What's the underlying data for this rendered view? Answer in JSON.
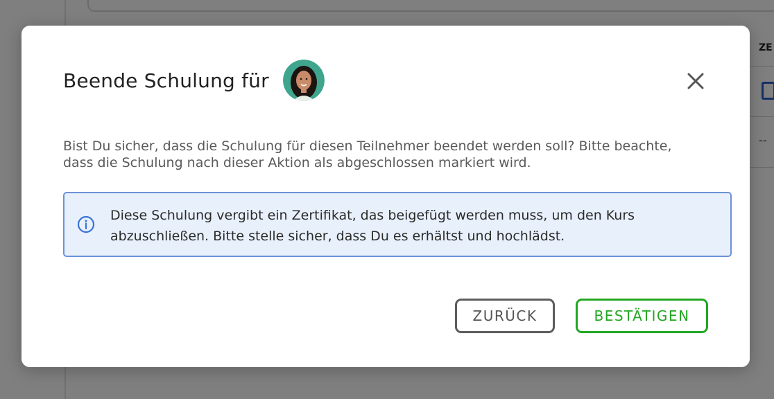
{
  "background": {
    "column_header": "ZE",
    "row_value": "--"
  },
  "dialog": {
    "title": "Beende Schulung für",
    "avatar_icon": "participant-avatar",
    "close_icon": "close-icon",
    "message": "Bist Du sicher, dass die Schulung für diesen Teilnehmer beendet werden soll? Bitte beachte, dass die Schulung nach dieser Aktion als abgeschlossen markiert wird.",
    "info": {
      "icon": "info-icon",
      "text": "Diese Schulung vergibt ein Zertifikat, das beigefügt werden muss, um den Kurs abzuschließen. Bitte stelle sicher, dass Du es erhältst und hochlädst."
    },
    "buttons": {
      "back_label": "ZURÜCK",
      "confirm_label": "BESTÄTIGEN"
    }
  },
  "colors": {
    "confirm": "#22a722",
    "info_border": "#6b92d8",
    "info_background": "#e8f0fb"
  }
}
